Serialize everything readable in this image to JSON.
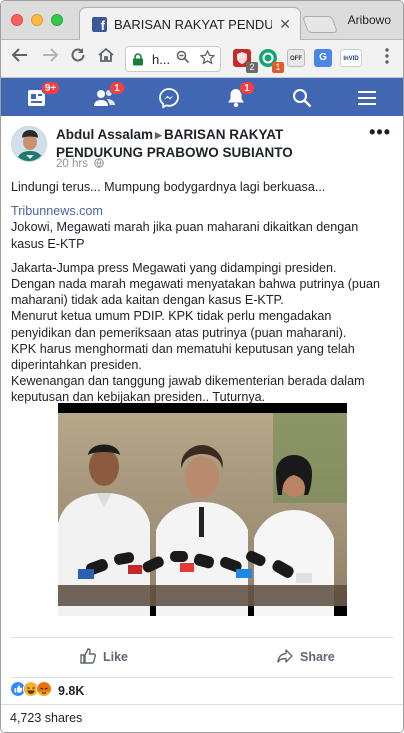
{
  "browser": {
    "tab_title": "BARISAN RAKYAT PENDUKUNG PRABOWO SUBIANTO",
    "tab_close": "✕",
    "favicon_letter": "f",
    "profile_name": "Aribowo",
    "omnibox_text": "h..."
  },
  "extensions": [
    {
      "name": "ublock",
      "badge": "2",
      "color": "#c42a2a",
      "badge_color": "#6a6a6a"
    },
    {
      "name": "grammarly",
      "badge": "1",
      "color": "#15a374",
      "badge_color": "#e15b2a"
    },
    {
      "name": "off",
      "label": "OFF",
      "color": "#e8e8e8"
    },
    {
      "name": "translate",
      "label": "G",
      "color": "#4a86e8"
    },
    {
      "name": "invid",
      "label": "InVID",
      "color": "#ffffff"
    }
  ],
  "fb_nav": {
    "pages_badge": "9+",
    "friends_badge": "1",
    "notifications_badge": "1"
  },
  "post": {
    "author": "Abdul Assalam",
    "group": "BARISAN RAKYAT PENDUKUNG PRABOWO SUBIANTO",
    "time": "20 hrs",
    "more": "•••",
    "lines": [
      "Lindungi terus... Mumpung bodygardnya lagi berkuasa...",
      "",
      "Tribunnews.com",
      "Jokowi, Megawati marah jika puan maharani dikaitkan dengan",
      "kasus E-KTP",
      "",
      "Jakarta-Jumpa press Megawati yang didampingi presiden.",
      "Dengan nada marah megawati menyatakan bahwa putrinya (puan",
      "maharani) tidak ada kaitan dengan kasus E-KTP.",
      "Menurut ketua umum PDIP. KPK tidak perlu mengadakan",
      "penyidikan dan pemeriksaan atas putrinya (puan maharani).",
      "KPK harus menghormati dan mematuhi keputusan yang telah",
      "diperintahkan presiden.",
      "Kewenangan dan tanggung jawab dikementerian berada dalam",
      "keputusan dan kebijakan presiden.. Tuturnya."
    ],
    "like_label": "Like",
    "share_label": "Share",
    "reaction_count": "9.8K",
    "shares": "4,723 shares"
  }
}
